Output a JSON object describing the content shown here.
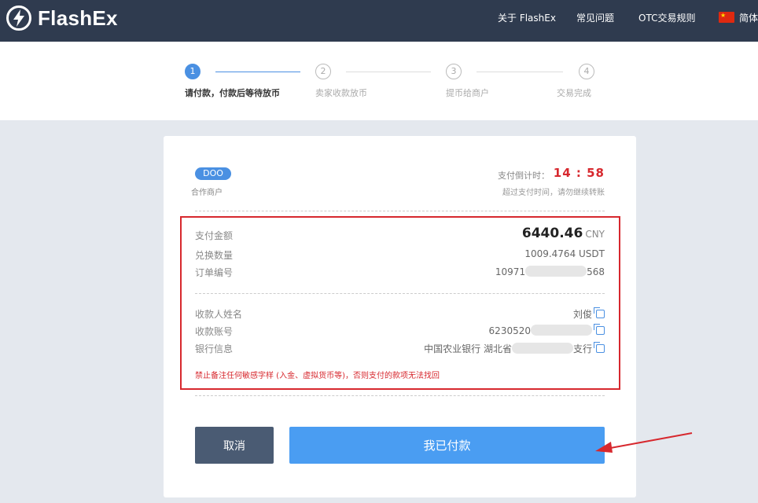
{
  "header": {
    "brand": "FlashEx",
    "nav": [
      "关于 FlashEx",
      "常见问题",
      "OTC交易规则"
    ],
    "language": "简体"
  },
  "steps": [
    {
      "num": "1",
      "label": "请付款，付款后等待放币",
      "active": true
    },
    {
      "num": "2",
      "label": "卖家收款放币",
      "active": false
    },
    {
      "num": "3",
      "label": "提币给商户",
      "active": false
    },
    {
      "num": "4",
      "label": "交易完成",
      "active": false
    }
  ],
  "order": {
    "merchant_badge": "DOO",
    "merchant_label": "合作商户",
    "countdown_label": "支付倒计时：",
    "countdown": "14 : 58",
    "timeout_note": "超过支付时间，请勿继续转账",
    "amount_label": "支付金额",
    "amount": "6440.46",
    "amount_currency": "CNY",
    "exchange_label": "兑换数量",
    "exchange_value": "1009.4764 USDT",
    "order_no_label": "订单编号",
    "order_no_prefix": "10971",
    "order_no_suffix": "568",
    "payee_label": "收款人姓名",
    "payee_value": "刘俊",
    "account_label": "收款账号",
    "account_prefix": "6230520",
    "bank_label": "银行信息",
    "bank_prefix": "中国农业银行 湖北省",
    "bank_suffix": "支行",
    "warning": "禁止备注任何敏感字样 (入金、虚拟货币等)，否则支付的款项无法找回"
  },
  "buttons": {
    "cancel": "取消",
    "paid": "我已付款"
  },
  "colors": {
    "header_bg": "#2f3b4f",
    "accent": "#4a90e2",
    "alert_red": "#d7282e",
    "cancel_bg": "#4a5b73",
    "paid_bg": "#4a9df2"
  }
}
